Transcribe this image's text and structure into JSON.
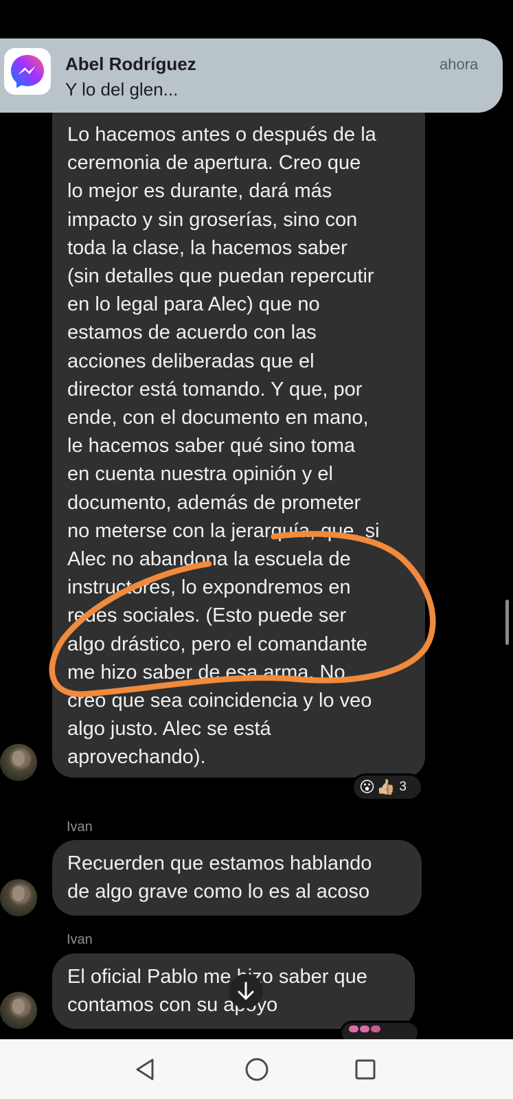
{
  "notification": {
    "app_icon": "messenger-icon",
    "sender": "Abel Rodríguez",
    "preview": "Y lo del glen...",
    "time": "ahora"
  },
  "messages": [
    {
      "sender": "",
      "text": "Lo hacemos antes o después de la\nceremonia de apertura. Creo que\nlo mejor es durante, dará más\nimpacto y sin groserías, sino con\ntoda la clase, la hacemos saber\n(sin detalles que puedan repercutir\nen lo legal para Alec) que no\nestamos de acuerdo con las\nacciones deliberadas que el\ndirector está tomando. Y que, por\nende, con el documento en mano,\nle hacemos saber qué sino toma\nen cuenta nuestra opinión y el\ndocumento, además de prometer\nno meterse con la jerarquía, que, si\nAlec no abandona la escuela de\ninstructores, lo expondremos en\nredes sociales. (Esto puede ser\nalgo drástico, pero el comandante\nme hizo saber de esa arma. No\ncreo que sea coincidencia y lo veo\nalgo justo. Alec se está\naprovechando).",
      "reactions": {
        "emojis": [
          "😮",
          "👍🏼"
        ],
        "count": "3"
      }
    },
    {
      "sender": "Ivan",
      "text": "Recuerden que estamos hablando\nde algo grave como lo es al acoso"
    },
    {
      "sender": "Ivan",
      "text": "El oficial Pablo me hizo saber que\ncontamos con su apoyo"
    }
  ],
  "annotation": {
    "color": "#f08a3c",
    "kind": "freehand circle"
  },
  "icons": {
    "scroll_down": "arrow-down-icon",
    "nav_back": "back-triangle-icon",
    "nav_home": "home-circle-icon",
    "nav_recent": "recent-apps-square-icon"
  },
  "colors": {
    "background": "#000000",
    "bubble": "#303030",
    "notification": "#b9c3ca",
    "annotation": "#f08a3c"
  }
}
